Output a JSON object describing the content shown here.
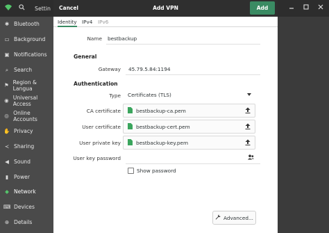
{
  "background_window": {
    "title": "Settin",
    "sidebar": [
      {
        "label": "Bluetooth",
        "icon": "bluetooth-icon"
      },
      {
        "label": "Background",
        "icon": "background-icon"
      },
      {
        "label": "Notifications",
        "icon": "notifications-icon"
      },
      {
        "label": "Search",
        "icon": "search-icon"
      },
      {
        "label": "Region & Langua",
        "icon": "region-icon"
      },
      {
        "label": "Universal Access",
        "icon": "universal-access-icon"
      },
      {
        "label": "Online Accounts",
        "icon": "online-accounts-icon"
      },
      {
        "label": "Privacy",
        "icon": "privacy-icon"
      },
      {
        "label": "Sharing",
        "icon": "sharing-icon"
      },
      {
        "label": "Sound",
        "icon": "sound-icon"
      },
      {
        "label": "Power",
        "icon": "power-icon"
      },
      {
        "label": "Network",
        "icon": "network-icon",
        "active": true
      },
      {
        "label": "Devices",
        "icon": "devices-icon"
      },
      {
        "label": "Details",
        "icon": "details-icon"
      }
    ]
  },
  "dialog": {
    "cancel_label": "Cancel",
    "title": "Add VPN",
    "add_label": "Add",
    "tabs": [
      "Identity",
      "IPv4",
      "IPv6"
    ],
    "name_label": "Name",
    "name_value": "bestbackup",
    "general_heading": "General",
    "gateway_label": "Gateway",
    "gateway_value": "45.79.5.84:1194",
    "auth_heading": "Authentication",
    "type_label": "Type",
    "type_value": "Certificates (TLS)",
    "ca_label": "CA certificate",
    "ca_file": "bestbackup-ca.pem",
    "user_cert_label": "User certificate",
    "user_cert_file": "bestbackup-cert.pem",
    "user_key_label": "User private key",
    "user_key_file": "bestbackup-key.pem",
    "password_label": "User key password",
    "password_value": "",
    "show_password_label": "Show password",
    "show_password_checked": false,
    "advanced_label": "Advanced..."
  },
  "colors": {
    "accent": "#3a8b63",
    "active_sidebar": "#54c56b",
    "header": "#2f2f2f"
  }
}
